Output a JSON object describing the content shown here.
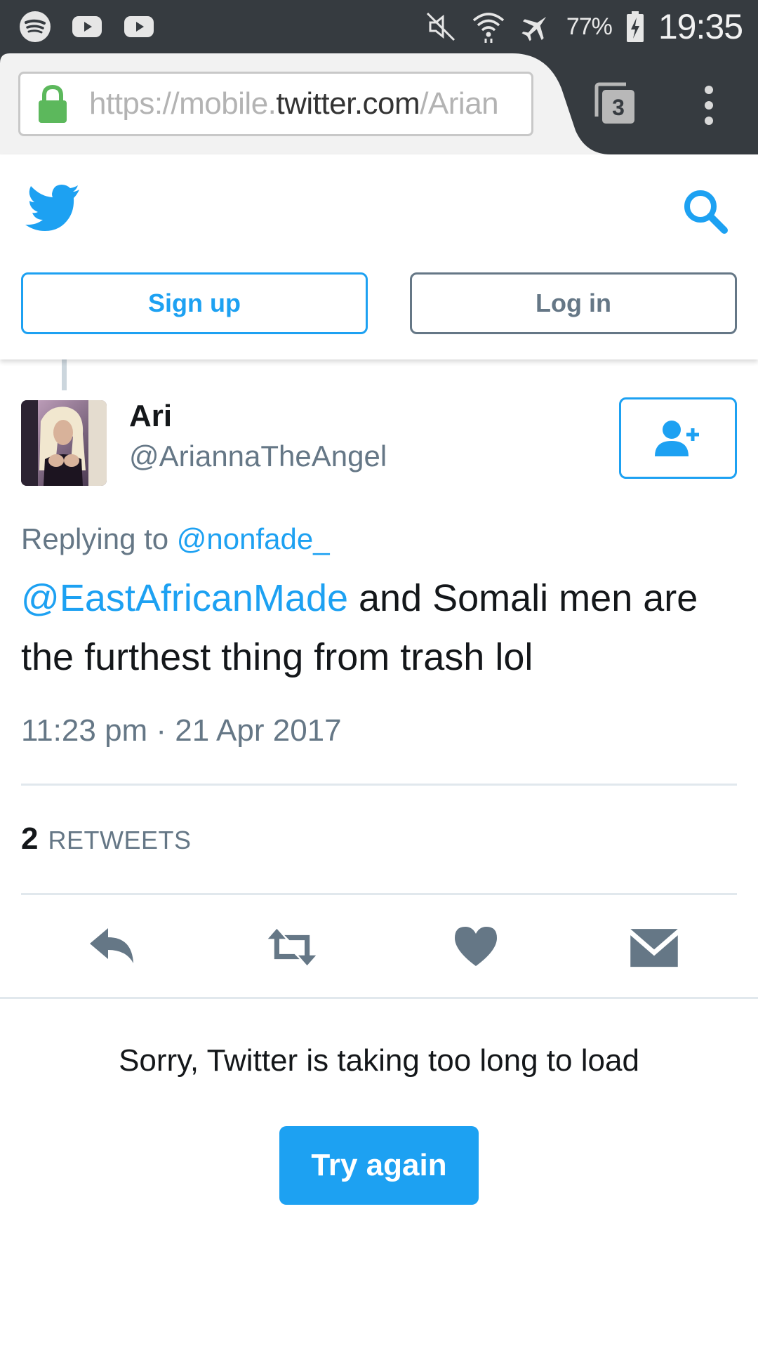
{
  "status_bar": {
    "battery_percent": "77%",
    "time": "19:35",
    "left_icons": [
      "spotify-icon",
      "youtube-icon",
      "youtube-icon"
    ],
    "right_icons": [
      "mute-icon",
      "wifi-icon",
      "airplane-icon",
      "battery-charging-icon"
    ]
  },
  "browser": {
    "url_prefix": "https://mobile.",
    "url_domain": "twitter.com",
    "url_suffix": "/Arian",
    "tab_count": "3",
    "colors": {
      "lock": "#5cb85c",
      "chrome_bg": "#363b40"
    }
  },
  "header": {
    "signup_label": "Sign up",
    "login_label": "Log in"
  },
  "tweet": {
    "author_name": "Ari",
    "author_handle": "@AriannaTheAngel",
    "replying_prefix": "Replying to ",
    "replying_to": "@nonfade_",
    "mention": "@EastAfricanMade",
    "text_rest": " and Somali men are the furthest thing from trash lol",
    "timestamp": "11:23 pm · 21 Apr 2017",
    "retweet_count": "2",
    "retweets_label": "RETWEETS"
  },
  "load_error": {
    "message": "Sorry, Twitter is taking too long to load",
    "retry_label": "Try again"
  },
  "colors": {
    "twitter_blue": "#1da1f2",
    "gray_text": "#657786",
    "icon_gray": "#657786"
  }
}
